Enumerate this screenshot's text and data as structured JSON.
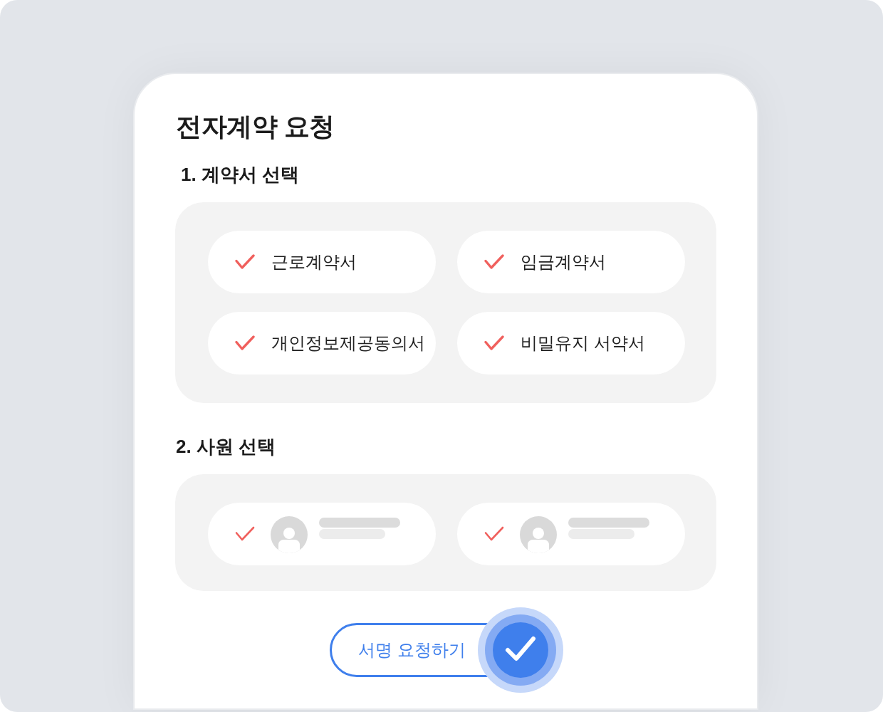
{
  "title": "전자계약 요청",
  "sections": [
    {
      "heading": "1. 계약서 선택",
      "kind": "contracts",
      "items": [
        {
          "label": "근로계약서",
          "checked": true
        },
        {
          "label": "임금계약서",
          "checked": true
        },
        {
          "label": "개인정보제공동의서",
          "checked": true
        },
        {
          "label": "비밀유지 서약서",
          "checked": true
        }
      ]
    },
    {
      "heading": "2. 사원 선택",
      "kind": "employees",
      "items": [
        {
          "checked": true
        },
        {
          "checked": true
        }
      ]
    }
  ],
  "submit_button": {
    "label": "서명 요청하기"
  }
}
